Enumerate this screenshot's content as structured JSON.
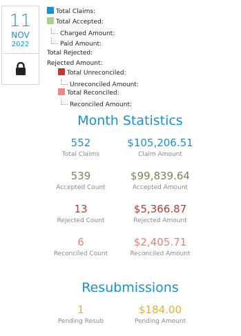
{
  "date_card": {
    "day": "11",
    "month": "NOV",
    "year": "2022",
    "lock_icon": "lock-icon"
  },
  "legend": {
    "total_claims": "Total Claims:",
    "total_accepted": "Total Accepted:",
    "charged_amount": "Charged Amount:",
    "paid_amount": "Paid Amount:",
    "total_rejected": "Total Rejected:",
    "rejected_amount": "Rejected Amount:",
    "total_unreconciled": "Total Unreconciled:",
    "unreconciled_amount": "Unreconciled Amount:",
    "total_reconciled": "Total Reconciled:",
    "reconciled_amount": "Reconciled Amount:",
    "colors": {
      "claims": "#1a8fd4",
      "accepted": "#a8cf96",
      "unreconciled": "#b93a3a",
      "reconciled": "#ef8585"
    }
  },
  "month_statistics": {
    "title": "Month Statistics",
    "rows": [
      {
        "left_value": "552",
        "left_label": "Total Claims",
        "right_value": "$105,206.51",
        "right_label": "Claim Amount",
        "color": "#1a8fd4"
      },
      {
        "left_value": "539",
        "left_label": "Accepted Count",
        "right_value": "$99,839.64",
        "right_label": "Accepted Amount",
        "color": "#6f8a57"
      },
      {
        "left_value": "13",
        "left_label": "Rejected Count",
        "right_value": "$5,366.87",
        "right_label": "Rejected Amount",
        "color": "#b93a3a"
      },
      {
        "left_value": "6",
        "left_label": "Reconciled Count",
        "right_value": "$2,405.71",
        "right_label": "Reconciled Amount",
        "color": "#ec7b7b"
      }
    ]
  },
  "resubmissions": {
    "title": "Resubmissions",
    "left_value": "1",
    "left_label": "Pending Resub",
    "right_value": "$184.00",
    "right_label": "Pending Amount",
    "color": "#e6b11f"
  }
}
